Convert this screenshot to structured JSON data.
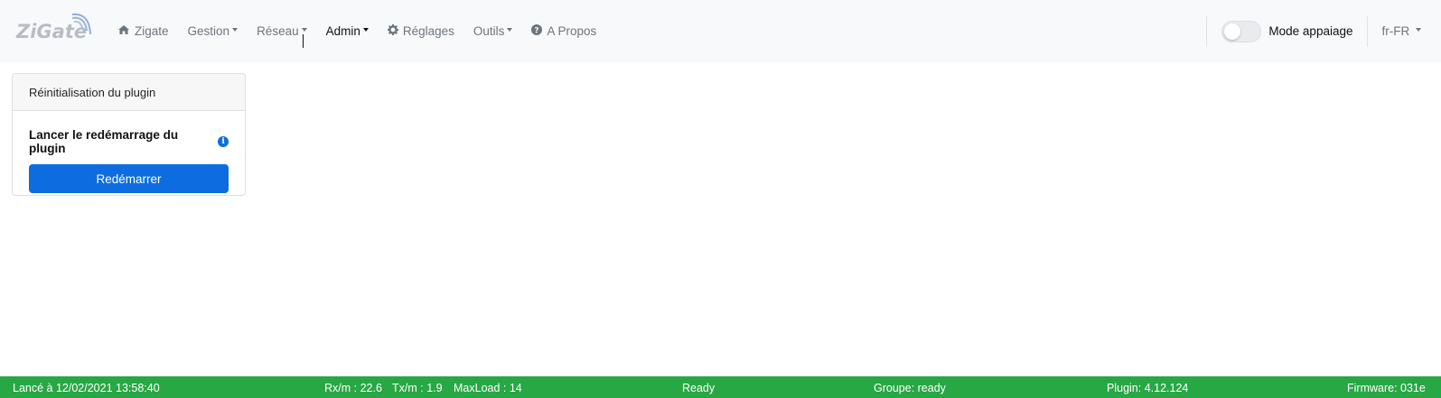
{
  "brand": {
    "name": "ZiGate"
  },
  "nav": {
    "items": [
      {
        "label": "Zigate",
        "icon": "home-icon"
      },
      {
        "label": "Gestion",
        "dropdown": true
      },
      {
        "label": "Réseau",
        "dropdown": true
      },
      {
        "label": "Admin",
        "dropdown": true,
        "active": true
      },
      {
        "label": "Réglages",
        "icon": "gear-icon"
      },
      {
        "label": "Outils",
        "dropdown": true
      },
      {
        "label": "A Propos",
        "icon": "question-circle-icon"
      }
    ]
  },
  "pairing": {
    "label": "Mode appaiage",
    "enabled": false
  },
  "language": {
    "label": "fr-FR"
  },
  "card": {
    "header": "Réinitialisation du plugin",
    "title": "Lancer le redémarrage du plugin",
    "info_icon": "i",
    "button_label": "Redémarrer"
  },
  "status": {
    "started": "Lancé à 12/02/2021 13:58:40",
    "rx": "Rx/m : 22.6",
    "tx": "Tx/m : 1.9",
    "maxload": "MaxLoad : 14",
    "state": "Ready",
    "groups": "Groupe: ready",
    "plugin": "Plugin: 4.12.124",
    "firmware": "Firmware: 031e"
  },
  "colors": {
    "primary": "#0d6de0",
    "status_bar": "#28a745",
    "navbar_bg": "#f8f9fa",
    "nav_text": "#6c757d"
  }
}
